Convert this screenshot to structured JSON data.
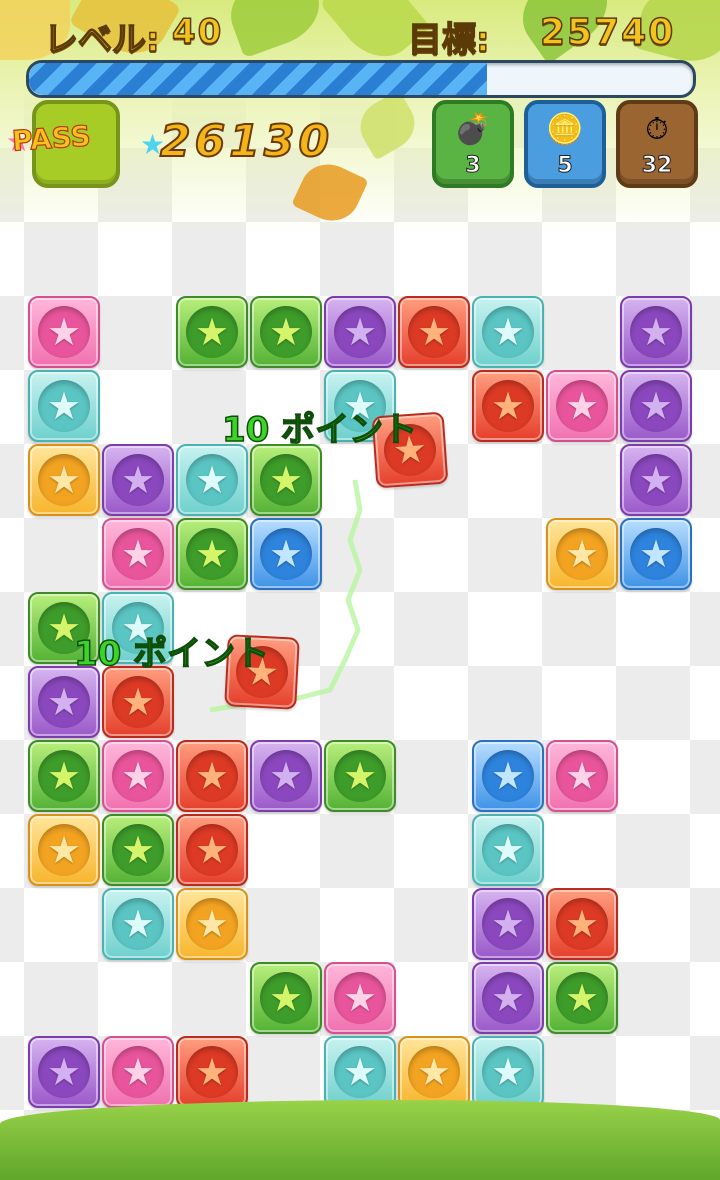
{
  "hud": {
    "level_label": "レベル:",
    "level_value": "40",
    "target_label": "目標:",
    "target_value": "25740",
    "progress_fraction": 0.69,
    "pass_label": "PASS",
    "score_value": "26130"
  },
  "powerups": [
    {
      "name": "bomb",
      "icon": "bomb-icon",
      "count": "3",
      "color": "#4fa33a"
    },
    {
      "name": "coins",
      "icon": "coins-icon",
      "count": "5",
      "color": "#3d8fd0"
    },
    {
      "name": "clock",
      "icon": "clock-icon",
      "count": "32",
      "color": "#8f5a2a"
    }
  ],
  "popups": [
    {
      "text": "10 ポイント"
    },
    {
      "text": "10 ポイント"
    }
  ],
  "colors": {
    "pink": "#f071b0",
    "teal": "#6fd0cd",
    "green": "#54b235",
    "purple": "#9a59c9",
    "red": "#e5402c",
    "orange": "#f7b52e",
    "blue": "#3f93e6"
  },
  "board": {
    "columns": 9,
    "rows": 11,
    "tiles": [
      [
        "pink",
        null,
        "green",
        "green",
        "purple",
        "red",
        "teal",
        null,
        "purple"
      ],
      [
        "teal",
        null,
        null,
        null,
        "teal",
        null,
        "red",
        "pink",
        "purple"
      ],
      [
        "orange",
        "purple",
        "teal",
        "green",
        null,
        null,
        null,
        null,
        "purple"
      ],
      [
        null,
        "pink",
        "green",
        "blue",
        null,
        null,
        null,
        "orange",
        "blue"
      ],
      [
        "green",
        "teal",
        null,
        null,
        null,
        null,
        null,
        null,
        null
      ],
      [
        "purple",
        "red",
        null,
        null,
        null,
        null,
        null,
        null,
        null
      ],
      [
        "green",
        "pink",
        "red",
        "purple",
        "green",
        null,
        "blue",
        "pink",
        null
      ],
      [
        "orange",
        "green",
        "red",
        null,
        null,
        null,
        "teal",
        null,
        null
      ],
      [
        null,
        "teal",
        "orange",
        null,
        null,
        null,
        "purple",
        "red",
        null
      ],
      [
        null,
        null,
        null,
        "green",
        "pink",
        null,
        "purple",
        "green",
        null
      ],
      [
        "purple",
        "pink",
        "red",
        null,
        "teal",
        "orange",
        "teal",
        null,
        null
      ]
    ],
    "falling_tiles": [
      "red",
      "red"
    ]
  }
}
